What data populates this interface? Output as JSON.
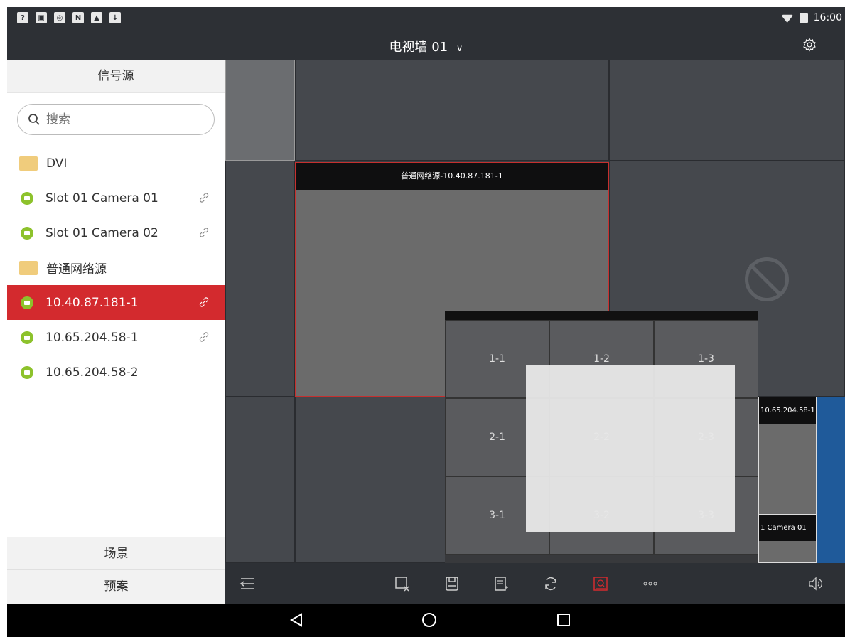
{
  "status_bar": {
    "left_icons": [
      "wifi-question-icon",
      "photo-icon",
      "vpn-icon",
      "n-icon",
      "image-icon",
      "download-icon"
    ],
    "time": "16:00"
  },
  "title_bar": {
    "title": "电视墙 01",
    "dropdown_glyph": "∨"
  },
  "sidebar": {
    "header": "信号源",
    "search_placeholder": "搜索",
    "items": [
      {
        "label": "DVI",
        "type": "folder",
        "linked": false
      },
      {
        "label": "Slot 01 Camera 01",
        "type": "camera",
        "linked": true
      },
      {
        "label": "Slot 01 Camera 02",
        "type": "camera",
        "linked": true
      },
      {
        "label": "普通网络源",
        "type": "folder",
        "linked": false
      },
      {
        "label": "10.40.87.181-1",
        "type": "camera",
        "linked": true,
        "selected": true
      },
      {
        "label": "10.65.204.58-1",
        "type": "camera",
        "linked": true
      },
      {
        "label": "10.65.204.58-2",
        "type": "camera",
        "linked": false
      }
    ],
    "footer_scene": "场景",
    "footer_plan": "预案"
  },
  "wall": {
    "window_main_title": "普通网络源-10.40.87.181-1",
    "window_right_title": "10.65.204.58-1",
    "window_right_bottom_title": "1 Camera 01"
  },
  "split_popup": {
    "cells": [
      "1-1",
      "1-2",
      "1-3",
      "2-1",
      "2-2",
      "2-3",
      "3-1",
      "3-2",
      "3-3"
    ]
  },
  "colors": {
    "accent": "#d32a2e",
    "camera_green": "#8dc22c",
    "folder_yellow": "#f0cc7c",
    "dark_bar": "#2d3035"
  }
}
